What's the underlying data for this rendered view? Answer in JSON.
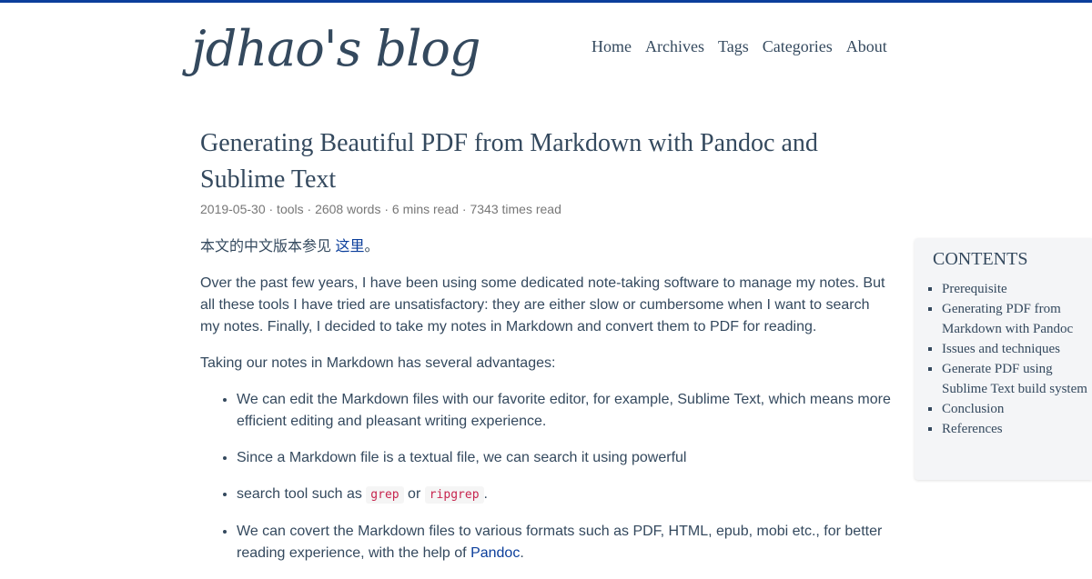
{
  "site": {
    "logo": "jdhao's blog",
    "nav": [
      "Home",
      "Archives",
      "Tags",
      "Categories",
      "About"
    ]
  },
  "post": {
    "title": "Generating Beautiful PDF from Markdown with Pandoc and Sublime Text",
    "meta": "2019-05-30 · tools · 2608 words · 6 mins read · 7343 times read",
    "cn_prefix": "本文的中文版本参见 ",
    "cn_link": "这里",
    "cn_suffix": "。",
    "p1": "Over the past few years, I have been using some dedicated note-taking software to manage my notes. But all these tools I have tried are unsatisfactory: they are either slow or cumbersome when I want to search my notes. Finally, I decided to take my notes in Markdown and convert them to PDF for reading.",
    "p2": "Taking our notes in Markdown has several advantages:",
    "li1": "We can edit the Markdown files with our favorite editor, for example, Sublime Text, which means more efficient editing and pleasant writing experience.",
    "li2": "Since a Markdown file is a textual file, we can search it using powerful",
    "li3_prefix": "search tool such as ",
    "li3_code1": "grep",
    "li3_mid": " or ",
    "li3_code2": "ripgrep",
    "li3_suffix": ".",
    "li4_prefix": "We can covert the Markdown files to various formats such as PDF, HTML, epub, mobi etc., for better reading experience, with the help of ",
    "li4_link": "Pandoc",
    "li4_suffix": "."
  },
  "toc": {
    "title": "CONTENTS",
    "items": [
      "Prerequisite",
      "Generating PDF from Markdown with Pandoc",
      "Issues and techniques",
      "Generate PDF using Sublime Text build system",
      "Conclusion",
      "References"
    ]
  }
}
